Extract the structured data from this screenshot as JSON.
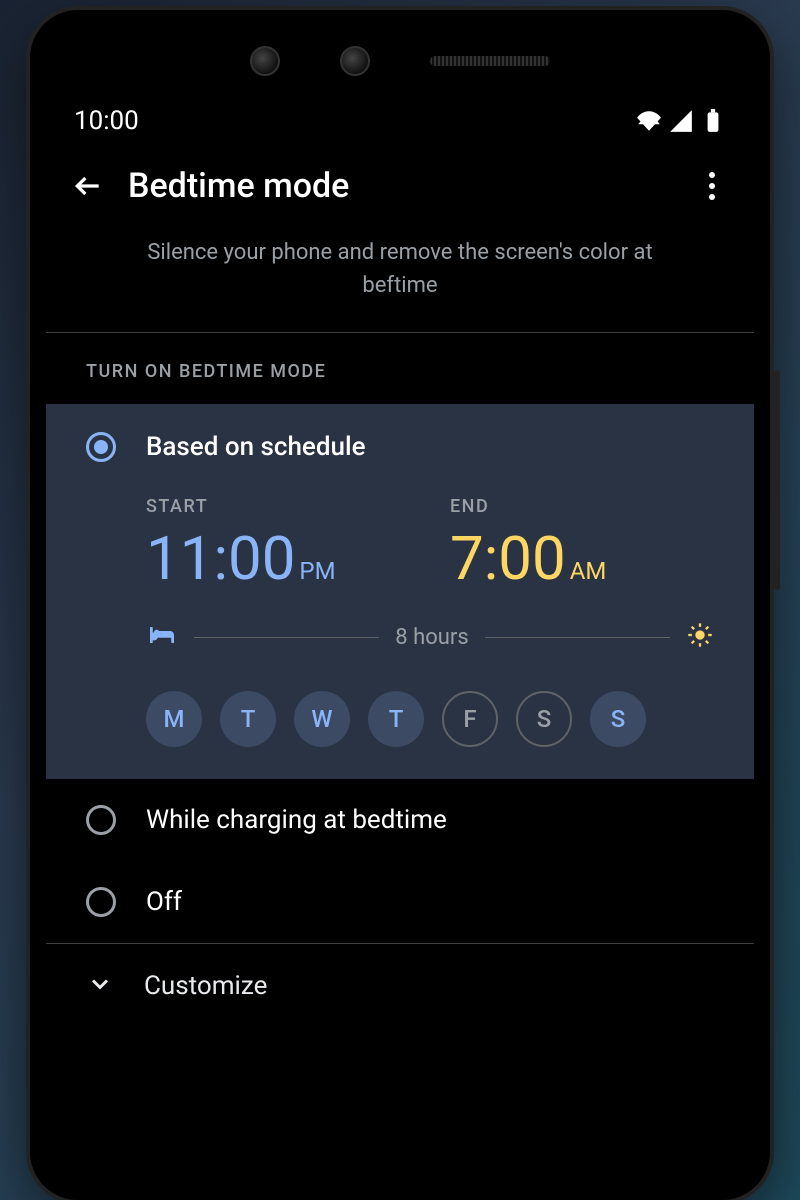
{
  "statusbar": {
    "time": "10:00"
  },
  "appbar": {
    "title": "Bedtime mode"
  },
  "description": "Silence your phone and remove the screen's color at beftime",
  "section_label": "TURN ON BEDTIME MODE",
  "options": {
    "schedule": {
      "label": "Based on schedule",
      "start_label": "START",
      "end_label": "END",
      "start_time": "11:00",
      "start_ampm": "PM",
      "end_time": "7:00",
      "end_ampm": "AM",
      "duration": "8 hours",
      "days": [
        {
          "letter": "M",
          "selected": true
        },
        {
          "letter": "T",
          "selected": true
        },
        {
          "letter": "W",
          "selected": true
        },
        {
          "letter": "T",
          "selected": true
        },
        {
          "letter": "F",
          "selected": false
        },
        {
          "letter": "S",
          "selected": false
        },
        {
          "letter": "S",
          "selected": true
        }
      ]
    },
    "charging": {
      "label": "While charging at bedtime"
    },
    "off": {
      "label": "Off"
    }
  },
  "customize": {
    "label": "Customize"
  }
}
